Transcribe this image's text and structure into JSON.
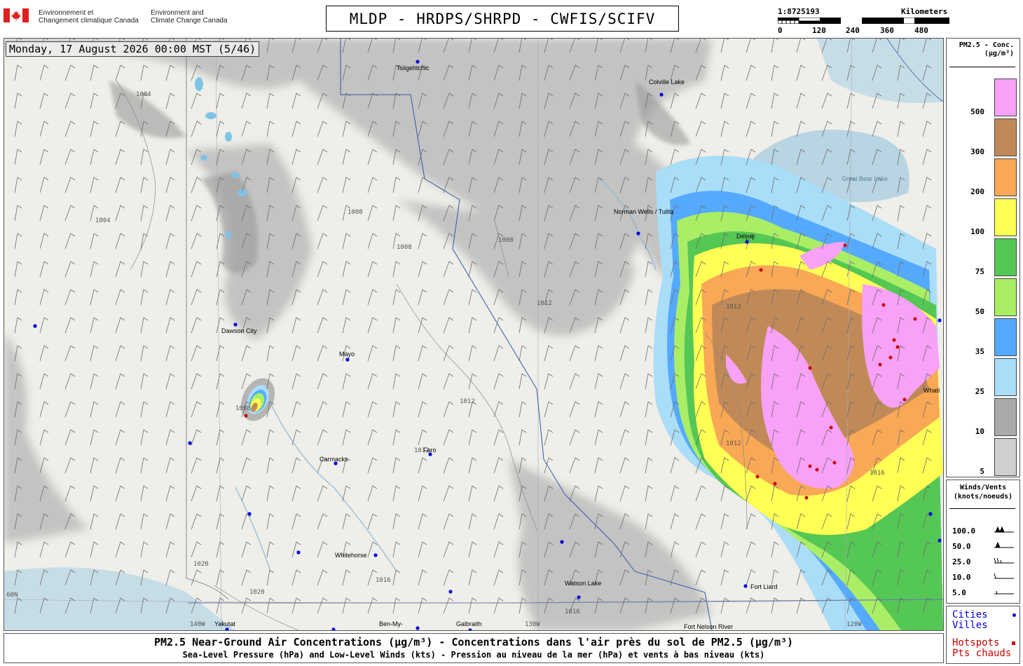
{
  "header": {
    "agency_fr": [
      "Environnement et",
      "Changement climatique Canada"
    ],
    "agency_en": [
      "Environment and",
      "Climate Change Canada"
    ],
    "title": "MLDP - HRDPS/SHRPD - CWFIS/SCIFV",
    "scale_ratio": "1:8725193",
    "scale_units": "Kilometers",
    "scale_ticks": [
      "0",
      "120",
      "240",
      "360",
      "480"
    ]
  },
  "map": {
    "date_label": "Monday, 17 August 2026 00:00 MST (5/46)",
    "places": [
      "Tsiigehtchic",
      "Colville Lake",
      "Great Bear Lake",
      "Norman Wells / Tulita",
      "Délı̨nę",
      "Dawson City",
      "Mayo",
      "Faro",
      "Carmacks",
      "Whitehorse",
      "Watson Lake",
      "Fort Liard",
      "Yakutat",
      "Ben-My-",
      "Galbraith",
      "Fort Nelson River",
      "Whatì"
    ],
    "isobars": [
      "1004",
      "1008",
      "1012",
      "1016",
      "1020"
    ],
    "longitudes": [
      "140W",
      "130W",
      "120W"
    ],
    "latitude": "60N"
  },
  "legend_pm": {
    "title_line1": "PM2.5 - Conc.",
    "title_line2": "(μg/m³)",
    "levels": [
      {
        "label": "500",
        "color": "#f7a1f7"
      },
      {
        "label": "300",
        "color": "#c08a58"
      },
      {
        "label": "200",
        "color": "#f9a855"
      },
      {
        "label": "100",
        "color": "#ffff55"
      },
      {
        "label": "75",
        "color": "#55c755"
      },
      {
        "label": "50",
        "color": "#aaee66"
      },
      {
        "label": "35",
        "color": "#55aaff"
      },
      {
        "label": "25",
        "color": "#aaddf8"
      },
      {
        "label": "10",
        "color": "#aaaaaa"
      },
      {
        "label": "5",
        "color": "#cfcfcf"
      }
    ]
  },
  "legend_wind": {
    "title_line1": "Winds/Vents",
    "title_line2": "(knots/noeuds)",
    "values": [
      "100.0",
      "50.0",
      "25.0",
      "10.0",
      "5.0"
    ]
  },
  "legend_points": {
    "cities_en": "Cities",
    "cities_fr": "Villes",
    "hotspots_en": "Hotspots",
    "hotspots_fr": "Pts chauds",
    "city_color": "#0000dd",
    "hotspot_color": "#cc0000"
  },
  "footer": {
    "line1": "PM2.5 Near-Ground Air Concentrations (μg/m³) - Concentrations dans l'air près du sol de PM2.5 (μg/m³)",
    "line2": "Sea-Level Pressure (hPa) and Low-Level Winds (kts) - Pression au niveau de la mer (hPa) et vents à bas niveau (kts)"
  }
}
